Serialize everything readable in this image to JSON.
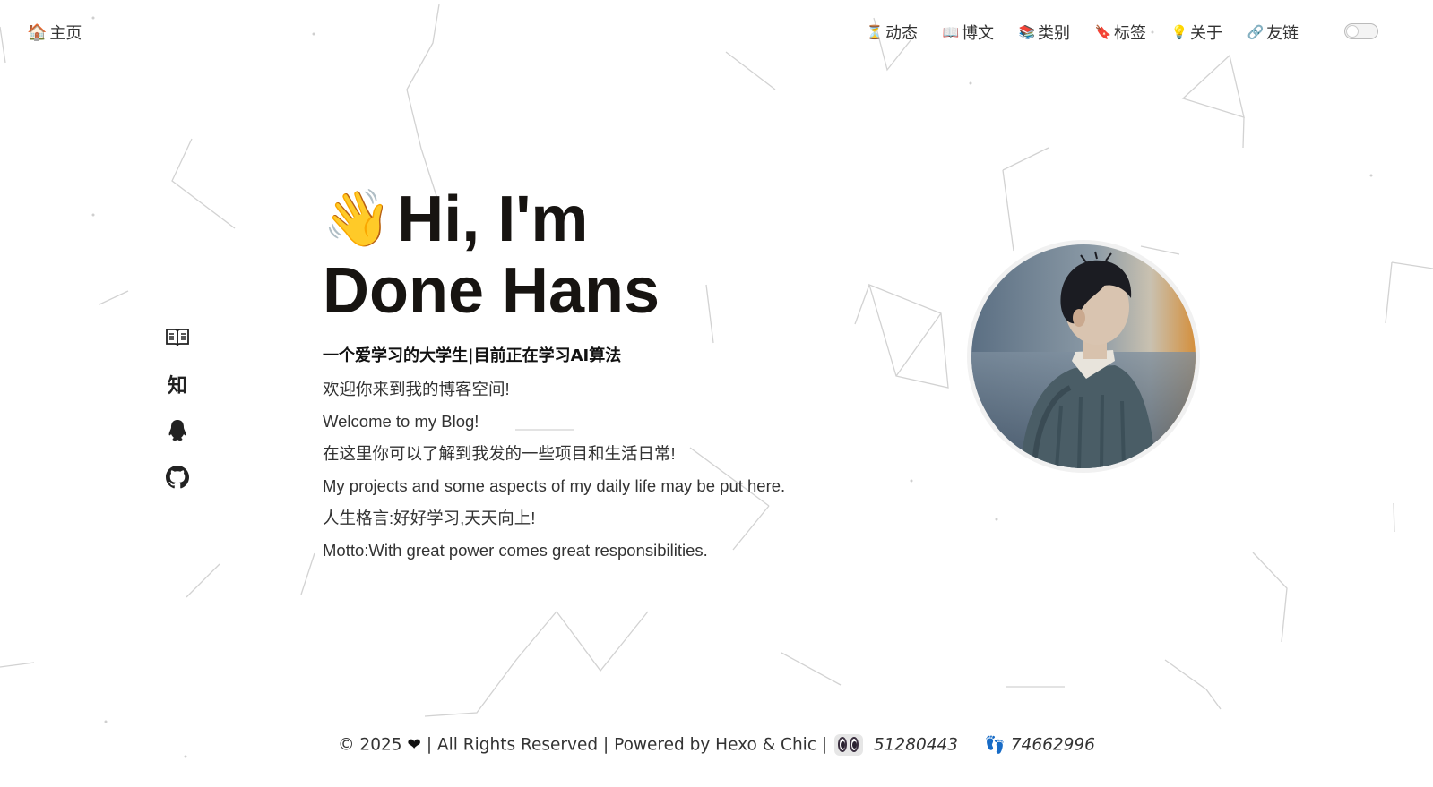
{
  "header": {
    "home": {
      "emoji": "🏠",
      "label": "主页"
    },
    "nav": [
      {
        "emoji": "⏳",
        "label": "动态"
      },
      {
        "emoji": "📖",
        "label": "博文"
      },
      {
        "emoji": "📚",
        "label": "类别"
      },
      {
        "emoji": "🔖",
        "label": "标签"
      },
      {
        "emoji": "💡",
        "label": "关于"
      },
      {
        "emoji": "🔗",
        "label": "友链"
      }
    ],
    "theme_toggle_state": "off"
  },
  "social": [
    {
      "name": "book-icon"
    },
    {
      "name": "zhihu-icon",
      "glyph": "知"
    },
    {
      "name": "qq-icon"
    },
    {
      "name": "github-icon"
    }
  ],
  "intro": {
    "wave_emoji": "👋",
    "title_line1": "Hi, I'm",
    "title_line2": "Done Hans",
    "subtitle": "一个爱学习的大学生|目前正在学习AI算法",
    "lines": [
      "欢迎你来到我的博客空间!",
      "Welcome to my Blog!",
      "在这里你可以了解到我发的一些项目和生活日常!",
      "My projects and some aspects of my daily life may be put here.",
      "人生格言:好好学习,天天向上!",
      "Motto:With great power comes great responsibilities."
    ]
  },
  "footer": {
    "copyright": "© 2025",
    "heart": "❤",
    "rights": "| All Rights Reserved | Powered by Hexo & Chic |",
    "views": "51280443",
    "visitors_emoji": "👣",
    "visitors": "74662996"
  },
  "colors": {
    "title": "#171411",
    "text": "#333333",
    "network_line": "#d6d6d6"
  }
}
